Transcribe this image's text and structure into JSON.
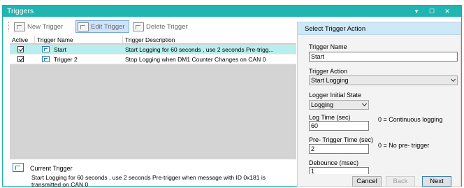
{
  "window": {
    "title": "Triggers",
    "controls": [
      "chevron-down-icon",
      "maximize-icon",
      "close-icon"
    ]
  },
  "toolbar": {
    "new_label": "New Trigger",
    "edit_label": "Edit Trigger",
    "delete_label": "Delete Trigger"
  },
  "grid": {
    "columns": [
      "Active",
      "Trigger Name",
      "Trigger Description"
    ],
    "rows": [
      {
        "active": true,
        "name": "Start",
        "description": "Start Logging for 60 seconds , use 2 seconds Pre-trigg...",
        "selected": true
      },
      {
        "active": true,
        "name": "Trigger 2",
        "description": "Stop Logging when DM1 Counter Changes on CAN 0",
        "selected": false
      }
    ]
  },
  "current_trigger": {
    "label": "Current Trigger",
    "description": "Start Logging for 60 seconds , use 2 seconds Pre-trigger when message with ID 0x181 is transmitted on CAN 0"
  },
  "panel": {
    "title": "Select Trigger Action",
    "trigger_name_label": "Trigger Name",
    "trigger_name_value": "Start",
    "trigger_action_label": "Trigger Action",
    "trigger_action_value": "Start Logging",
    "logger_state_label": "Logger Initial State",
    "logger_state_value": "Logging",
    "log_time_label": "Log Time (sec)",
    "log_time_value": "60",
    "log_time_note": "0 = Continuous logging",
    "pretrigger_label": "Pre- Trigger Time (sec)",
    "pretrigger_value": "2",
    "pretrigger_note": "0 = No pre- trigger",
    "debounce_label": "Debounce (msec)",
    "debounce_value": "1",
    "buttons": {
      "cancel": "Cancel",
      "back": "Back",
      "next": "Next"
    }
  },
  "colors": {
    "titlebar": "#21b5b2",
    "selected_row": "#b7eeee",
    "panel_header": "#cde8f7",
    "grid_background": "#d4d4d4"
  }
}
